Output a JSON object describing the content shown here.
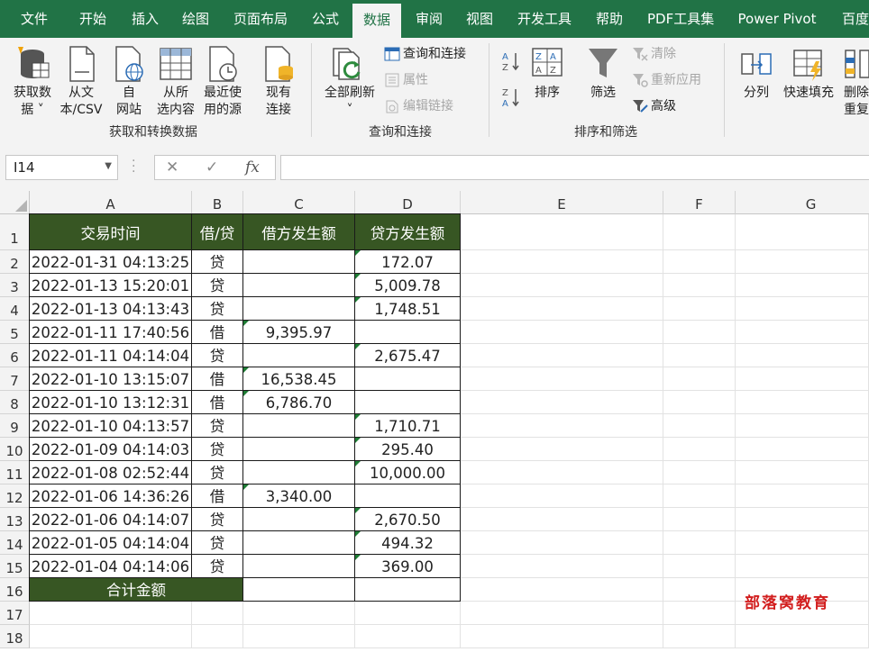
{
  "ribbon_tabs": [
    "文件",
    "开始",
    "插入",
    "绘图",
    "页面布局",
    "公式",
    "数据",
    "审阅",
    "视图",
    "开发工具",
    "帮助",
    "PDF工具集",
    "Power Pivot",
    "百度"
  ],
  "active_tab": "数据",
  "groups": {
    "get_transform": {
      "label": "获取和转换数据",
      "get_data_line1": "获取数",
      "get_data_line2": "据 ˅",
      "from_csv_line1": "从文",
      "from_csv_line2": "本/CSV",
      "from_web_line1": "自",
      "from_web_line2": "网站",
      "from_table_line1": "从所",
      "from_table_line2": "选内容",
      "recent_line1": "最近使",
      "recent_line2": "用的源",
      "existing_line1": "现有",
      "existing_line2": "连接"
    },
    "queries": {
      "label": "查询和连接",
      "refresh_all": "全部刷新",
      "refresh_all_caret": "˅",
      "queries_connections": "查询和连接",
      "properties": "属性",
      "edit_links": "编辑链接"
    },
    "sort_filter": {
      "label": "排序和筛选",
      "sort": "排序",
      "filter": "筛选",
      "clear": "清除",
      "reapply": "重新应用",
      "advanced": "高级"
    },
    "data_tools": {
      "text_to_columns": "分列",
      "flash_fill": "快速填充",
      "remove_dup_line1": "删除",
      "remove_dup_line2": "重复"
    }
  },
  "formula_bar": {
    "name_box": "I14",
    "fx": "fx",
    "formula": ""
  },
  "columns": [
    "A",
    "B",
    "C",
    "D",
    "E",
    "F",
    "G"
  ],
  "rows": [
    "1",
    "2",
    "3",
    "4",
    "5",
    "6",
    "7",
    "8",
    "9",
    "10",
    "11",
    "12",
    "13",
    "14",
    "15",
    "16",
    "17",
    "18"
  ],
  "table": {
    "headers": [
      "交易时间",
      "借/贷",
      "借方发生额",
      "贷方发生额"
    ],
    "rows": [
      [
        "2022-01-31 04:13:25",
        "贷",
        "",
        "172.07"
      ],
      [
        "2022-01-13 15:20:01",
        "贷",
        "",
        "5,009.78"
      ],
      [
        "2022-01-13 04:13:43",
        "贷",
        "",
        "1,748.51"
      ],
      [
        "2022-01-11 17:40:56",
        "借",
        "9,395.97",
        ""
      ],
      [
        "2022-01-11 04:14:04",
        "贷",
        "",
        "2,675.47"
      ],
      [
        "2022-01-10 13:15:07",
        "借",
        "16,538.45",
        ""
      ],
      [
        "2022-01-10 13:12:31",
        "借",
        "6,786.70",
        ""
      ],
      [
        "2022-01-10 04:13:57",
        "贷",
        "",
        "1,710.71"
      ],
      [
        "2022-01-09 04:14:03",
        "贷",
        "",
        "295.40"
      ],
      [
        "2022-01-08 02:52:44",
        "贷",
        "",
        "10,000.00"
      ],
      [
        "2022-01-06 14:36:26",
        "借",
        "3,340.00",
        ""
      ],
      [
        "2022-01-06 04:14:07",
        "贷",
        "",
        "2,670.50"
      ],
      [
        "2022-01-05 04:14:04",
        "贷",
        "",
        "494.32"
      ],
      [
        "2022-01-04 04:14:06",
        "贷",
        "",
        "369.00"
      ]
    ],
    "total_label": "合计金额"
  },
  "watermark": "部落窝教育",
  "colors": {
    "excel_green": "#217346",
    "header_fill": "#375623",
    "error_indicator": "#1e7c34",
    "watermark": "#d21e1e"
  }
}
